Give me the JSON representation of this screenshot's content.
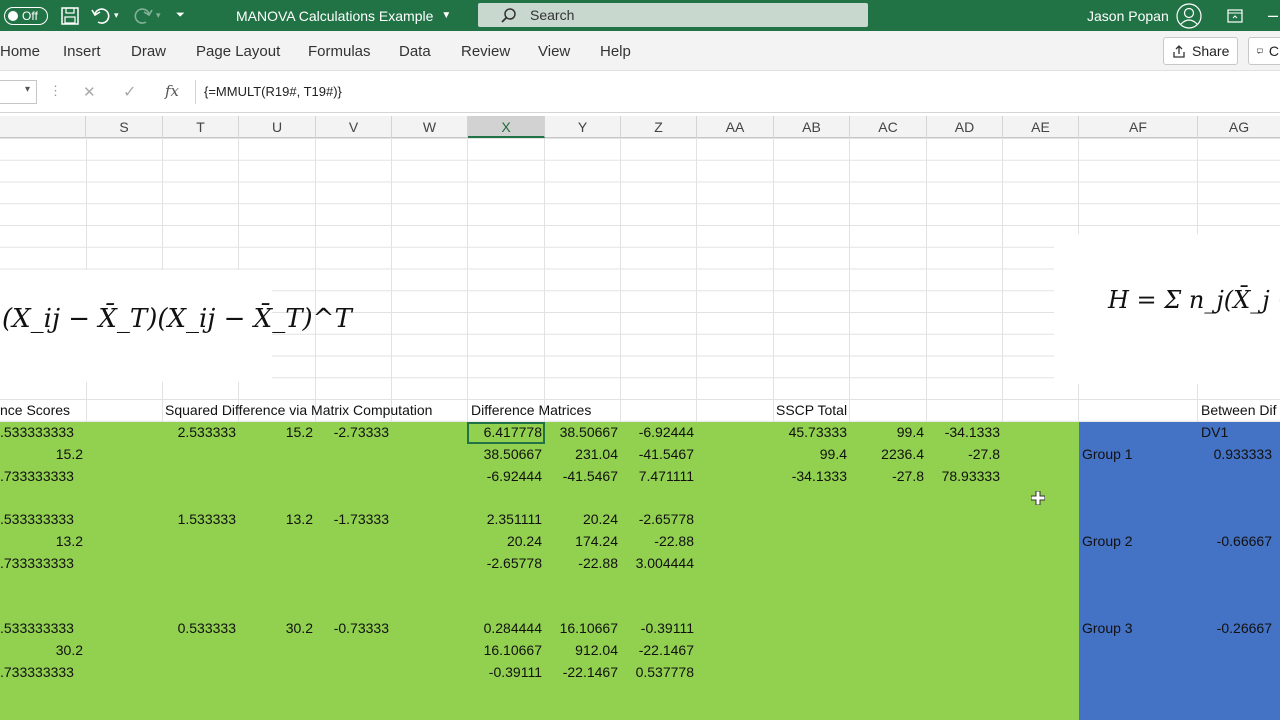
{
  "titlebar": {
    "autosave_label": "Off",
    "doc_title": "MANOVA Calculations Example",
    "search_placeholder": "Search",
    "user_name": "Jason Popan"
  },
  "ribbon": {
    "tabs": [
      "Home",
      "Insert",
      "Draw",
      "Page Layout",
      "Formulas",
      "Data",
      "Review",
      "View",
      "Help"
    ],
    "share_label": "Share",
    "comments_label": "C"
  },
  "formula_bar": {
    "cancel_symbol": "✕",
    "enter_symbol": "✓",
    "fx_label": "fx",
    "formula": "{=MMULT(R19#, T19#)}"
  },
  "columns": [
    "S",
    "T",
    "U",
    "V",
    "W",
    "X",
    "Y",
    "Z",
    "AA",
    "AB",
    "AC",
    "AD",
    "AE",
    "AF",
    "AG"
  ],
  "selected_column": "X",
  "equations": {
    "left": "(X_ij − X̄_T)(X_ij − X̄_T)^T",
    "right": "H = Σ n_j(X̄_j −"
  },
  "section_headers": {
    "deviance_scores": "nce Scores",
    "squared_diff": "Squared Difference via Matrix Computation",
    "diff_matrices": "Difference Matrices",
    "sscp_total": "SSCP Total",
    "between_diff": "Between Dif"
  },
  "col_r": [
    ".533333333",
    "15.2",
    ".733333333",
    ".533333333",
    "13.2",
    ".733333333",
    ".533333333",
    "30.2",
    ".733333333"
  ],
  "squared_diff_rows": [
    {
      "t": "2.533333",
      "u": "15.2",
      "v": "-2.73333"
    },
    {
      "t": "1.533333",
      "u": "13.2",
      "v": "-1.73333"
    },
    {
      "t": "0.533333",
      "u": "30.2",
      "v": "-0.73333"
    }
  ],
  "diff_matrices": [
    [
      "6.417778",
      "38.50667",
      "-6.92444"
    ],
    [
      "38.50667",
      "231.04",
      "-41.5467"
    ],
    [
      "-6.92444",
      "-41.5467",
      "7.471111"
    ],
    [
      "2.351111",
      "20.24",
      "-2.65778"
    ],
    [
      "20.24",
      "174.24",
      "-22.88"
    ],
    [
      "-2.65778",
      "-22.88",
      "3.004444"
    ],
    [
      "0.284444",
      "16.10667",
      "-0.39111"
    ],
    [
      "16.10667",
      "912.04",
      "-22.1467"
    ],
    [
      "-0.39111",
      "-22.1467",
      "0.537778"
    ]
  ],
  "sscp_total": [
    [
      "45.73333",
      "99.4",
      "-34.1333"
    ],
    [
      "99.4",
      "2236.4",
      "-27.8"
    ],
    [
      "-34.1333",
      "-27.8",
      "78.93333"
    ]
  ],
  "between": {
    "dv_header": "DV1",
    "groups": [
      {
        "label": "Group 1",
        "value": "0.933333"
      },
      {
        "label": "Group 2",
        "value": "-0.66667"
      },
      {
        "label": "Group 3",
        "value": "-0.26667"
      }
    ]
  },
  "colors": {
    "excel_green": "#217346",
    "fill_green": "#92d050",
    "fill_blue": "#4472c4"
  }
}
